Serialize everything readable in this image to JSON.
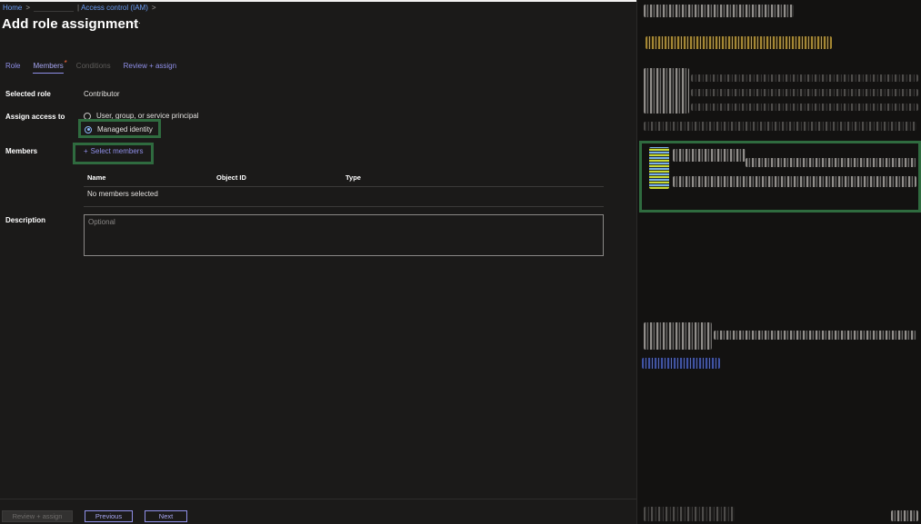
{
  "breadcrumb": {
    "home": "Home",
    "chevron": ">",
    "pipe": "|",
    "current": "Access control (IAM)"
  },
  "page": {
    "title": "Add role assignment",
    "more": "···"
  },
  "tabs": [
    {
      "label": "Role",
      "state": "normal"
    },
    {
      "label": "Members",
      "state": "active",
      "required_marker": "*"
    },
    {
      "label": "Conditions",
      "state": "disabled"
    },
    {
      "label": "Review + assign",
      "state": "normal"
    }
  ],
  "form": {
    "selected_role_label": "Selected role",
    "selected_role_value": "Contributor",
    "assign_access_label": "Assign access to",
    "options": [
      {
        "label": "User, group, or service principal",
        "checked": false
      },
      {
        "label": "Managed identity",
        "checked": true
      }
    ],
    "members_label": "Members",
    "select_members": "Select members",
    "plus_icon": "+",
    "table": {
      "columns": [
        "Name",
        "Object ID",
        "Type"
      ],
      "empty_text": "No members selected"
    },
    "description_label": "Description",
    "description_placeholder": "Optional",
    "description_value": ""
  },
  "footer": {
    "review_assign": "Review + assign",
    "previous": "Previous",
    "next": "Next"
  },
  "colors": {
    "background": "#1b1a19",
    "accent": "#8f8fe8",
    "highlight_box": "#2f6b3f",
    "link": "#6b9df5"
  }
}
